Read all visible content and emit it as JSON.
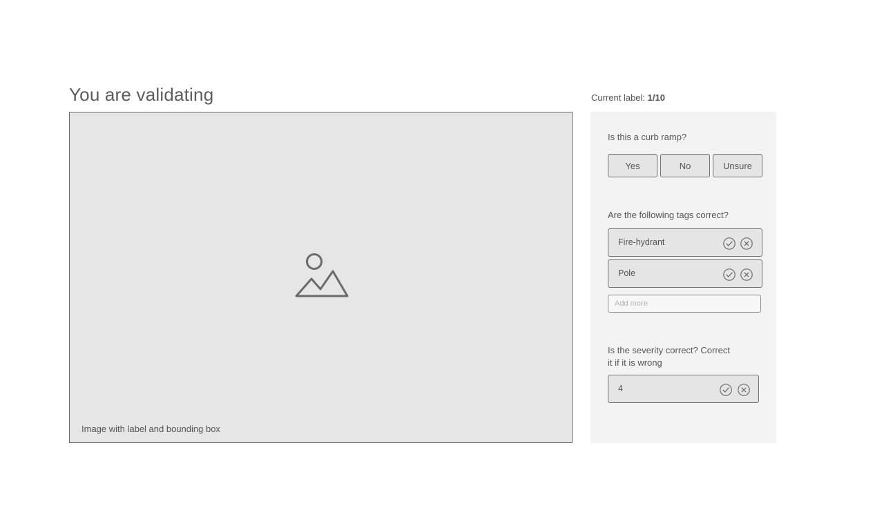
{
  "header": {
    "title": "You are validating"
  },
  "image_area": {
    "caption": "Image with label and bounding box",
    "icon": "image-placeholder-icon"
  },
  "counter": {
    "label": "Current label:",
    "value": "1/10"
  },
  "panel": {
    "curb_ramp": {
      "question": "Is this a curb ramp?",
      "options": [
        "Yes",
        "No",
        "Unsure"
      ]
    },
    "tags": {
      "question": "Are the following tags correct?",
      "items": [
        {
          "label": "Fire-hydrant"
        },
        {
          "label": "Pole"
        }
      ],
      "add_placeholder": "Add more",
      "accept_icon": "check-circle-icon",
      "reject_icon": "x-circle-icon"
    },
    "severity": {
      "question_line1": "Is the severity correct? Correct",
      "question_line2": "it if it is wrong",
      "value": "4"
    }
  },
  "colors": {
    "panel_bg": "#f3f3f3",
    "box_bg": "#e5e5e5",
    "border": "#6f6f6f",
    "text": "#555555"
  }
}
